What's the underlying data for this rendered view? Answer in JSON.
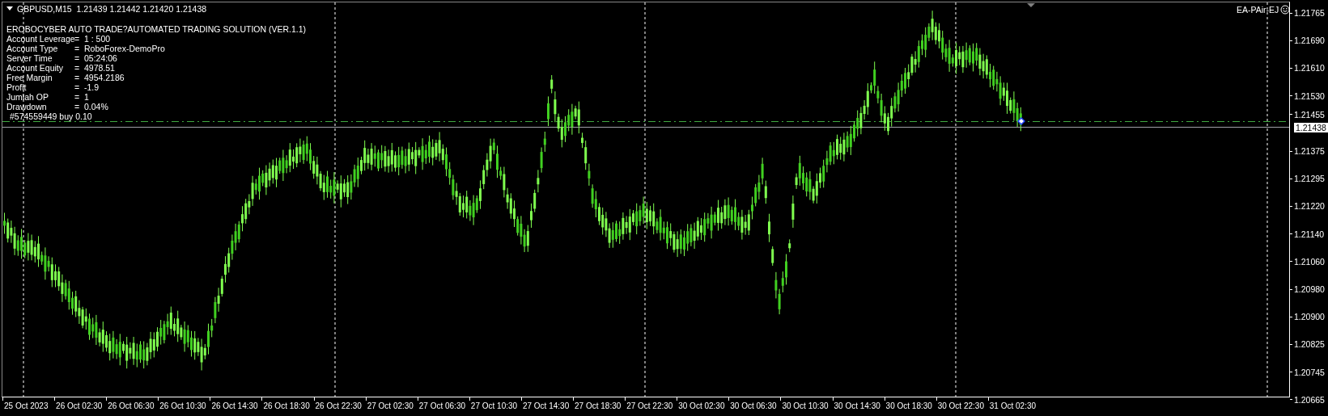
{
  "chart": {
    "symbol_line": "GBPUSD,M15  1.21439 1.21442 1.21420 1.21438",
    "expert_label": "EA-PAir-EJ",
    "info_title": "EROBOCYBER AUTO TRADE?AUTOMATED TRADING SOLUTION (VER.1.1)",
    "info_rows": [
      {
        "label": "Account Leverage",
        "value": "=  1 : 500"
      },
      {
        "label": "Account Type",
        "value": "=  RoboForex-DemoPro"
      },
      {
        "label": "Server Time",
        "value": "=  05:24:06"
      },
      {
        "label": "Account Equity",
        "value": "=  4978.51"
      },
      {
        "label": "Free Margin",
        "value": "=  4954.2186"
      },
      {
        "label": "Profit",
        "value": "=  -1.9"
      },
      {
        "label": "Jumlah OP",
        "value": "=  1"
      },
      {
        "label": "Drawdown",
        "value": "=  0.04%"
      }
    ],
    "order_label": "#574559449 buy 0.10",
    "price_axis": [
      "1.21765",
      "1.21690",
      "1.21610",
      "1.21530",
      "1.21455",
      "1.21375",
      "1.21295",
      "1.21220",
      "1.21140",
      "1.21060",
      "1.20980",
      "1.20900",
      "1.20825",
      "1.20745",
      "1.20665"
    ],
    "current_price": "1.21438",
    "time_axis": [
      "25 Oct 2023",
      "26 Oct 02:30",
      "26 Oct 06:30",
      "26 Oct 10:30",
      "26 Oct 14:30",
      "26 Oct 18:30",
      "26 Oct 22:30",
      "27 Oct 02:30",
      "27 Oct 06:30",
      "27 Oct 10:30",
      "27 Oct 14:30",
      "27 Oct 18:30",
      "27 Oct 22:30",
      "30 Oct 02:30",
      "30 Oct 06:30",
      "30 Oct 10:30",
      "30 Oct 14:30",
      "30 Oct 18:30",
      "30 Oct 22:30",
      "31 Oct 02:30"
    ]
  }
}
